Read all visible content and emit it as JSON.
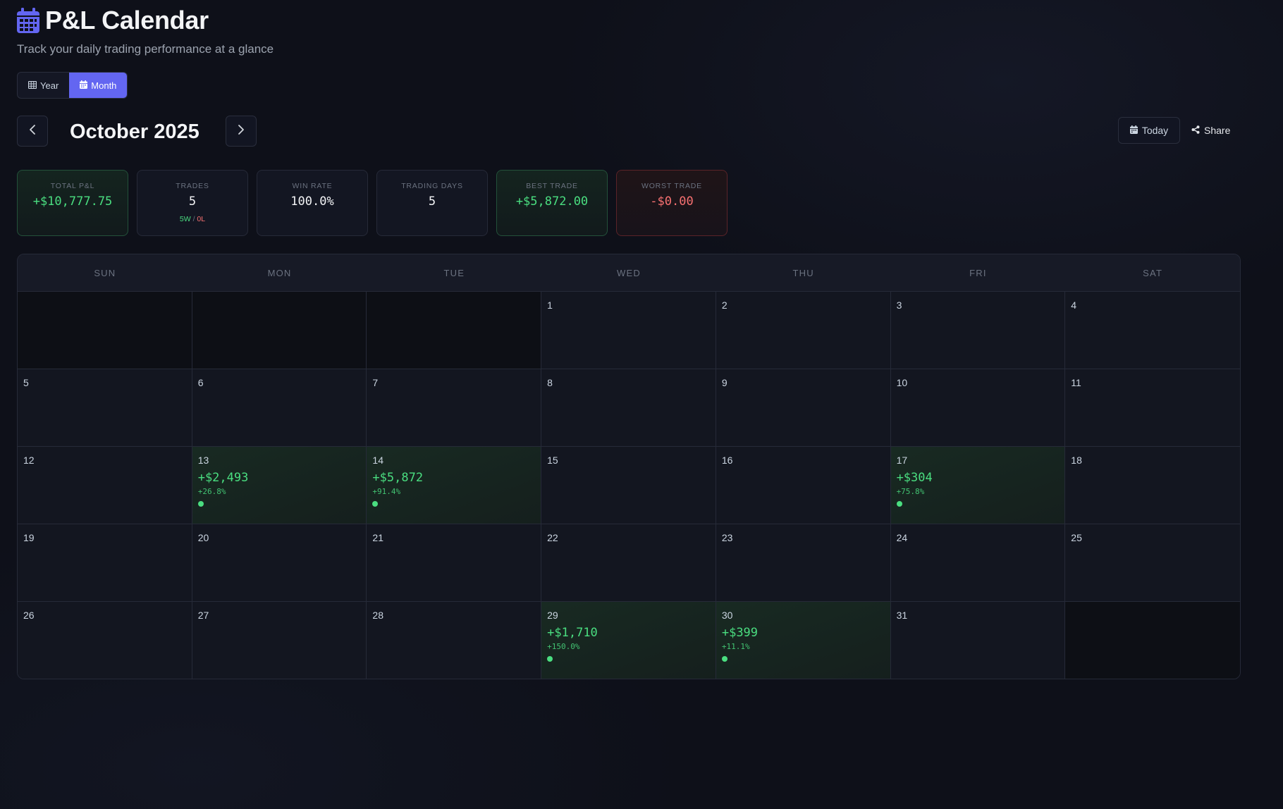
{
  "header": {
    "title": "P&L Calendar",
    "subtitle": "Track your daily trading performance at a glance",
    "icon": "calendar-icon",
    "accent_color": "#6366f1"
  },
  "view_toggle": {
    "options": [
      {
        "label": "Year",
        "icon": "table-grid-icon",
        "active": false
      },
      {
        "label": "Month",
        "icon": "calendar-icon",
        "active": true
      }
    ]
  },
  "nav": {
    "month_label": "October 2025",
    "prev_icon": "chevron-left-icon",
    "next_icon": "chevron-right-icon",
    "today_label": "Today",
    "share_label": "Share"
  },
  "stats": {
    "total_pnl": {
      "label": "TOTAL P&L",
      "value": "+$10,777.75",
      "tone": "positive"
    },
    "trades": {
      "label": "TRADES",
      "value": "5",
      "wins": "5W",
      "separator": "/",
      "losses": "0L"
    },
    "win_rate": {
      "label": "WIN RATE",
      "value": "100.0%"
    },
    "trading_days": {
      "label": "TRADING DAYS",
      "value": "5"
    },
    "best_trade": {
      "label": "BEST TRADE",
      "value": "+$5,872.00",
      "tone": "positive"
    },
    "worst_trade": {
      "label": "WORST TRADE",
      "value": "-$0.00",
      "tone": "negative"
    }
  },
  "calendar": {
    "weekdays": [
      "SUN",
      "MON",
      "TUE",
      "WED",
      "THU",
      "FRI",
      "SAT"
    ],
    "leading_empty": 3,
    "trailing_empty": 1,
    "days": [
      {
        "day": "1"
      },
      {
        "day": "2"
      },
      {
        "day": "3"
      },
      {
        "day": "4"
      },
      {
        "day": "5"
      },
      {
        "day": "6"
      },
      {
        "day": "7"
      },
      {
        "day": "8"
      },
      {
        "day": "9"
      },
      {
        "day": "10"
      },
      {
        "day": "11"
      },
      {
        "day": "12"
      },
      {
        "day": "13",
        "pnl": "+$2,493",
        "pct": "+26.8%"
      },
      {
        "day": "14",
        "pnl": "+$5,872",
        "pct": "+91.4%"
      },
      {
        "day": "15"
      },
      {
        "day": "16"
      },
      {
        "day": "17",
        "pnl": "+$304",
        "pct": "+75.8%"
      },
      {
        "day": "18"
      },
      {
        "day": "19"
      },
      {
        "day": "20"
      },
      {
        "day": "21"
      },
      {
        "day": "22"
      },
      {
        "day": "23"
      },
      {
        "day": "24"
      },
      {
        "day": "25"
      },
      {
        "day": "26"
      },
      {
        "day": "27"
      },
      {
        "day": "28"
      },
      {
        "day": "29",
        "pnl": "+$1,710",
        "pct": "+150.0%"
      },
      {
        "day": "30",
        "pnl": "+$399",
        "pct": "+11.1%"
      },
      {
        "day": "31"
      }
    ]
  },
  "colors": {
    "profit": "#4ade80",
    "loss": "#f87171",
    "background": "#0e1019"
  }
}
